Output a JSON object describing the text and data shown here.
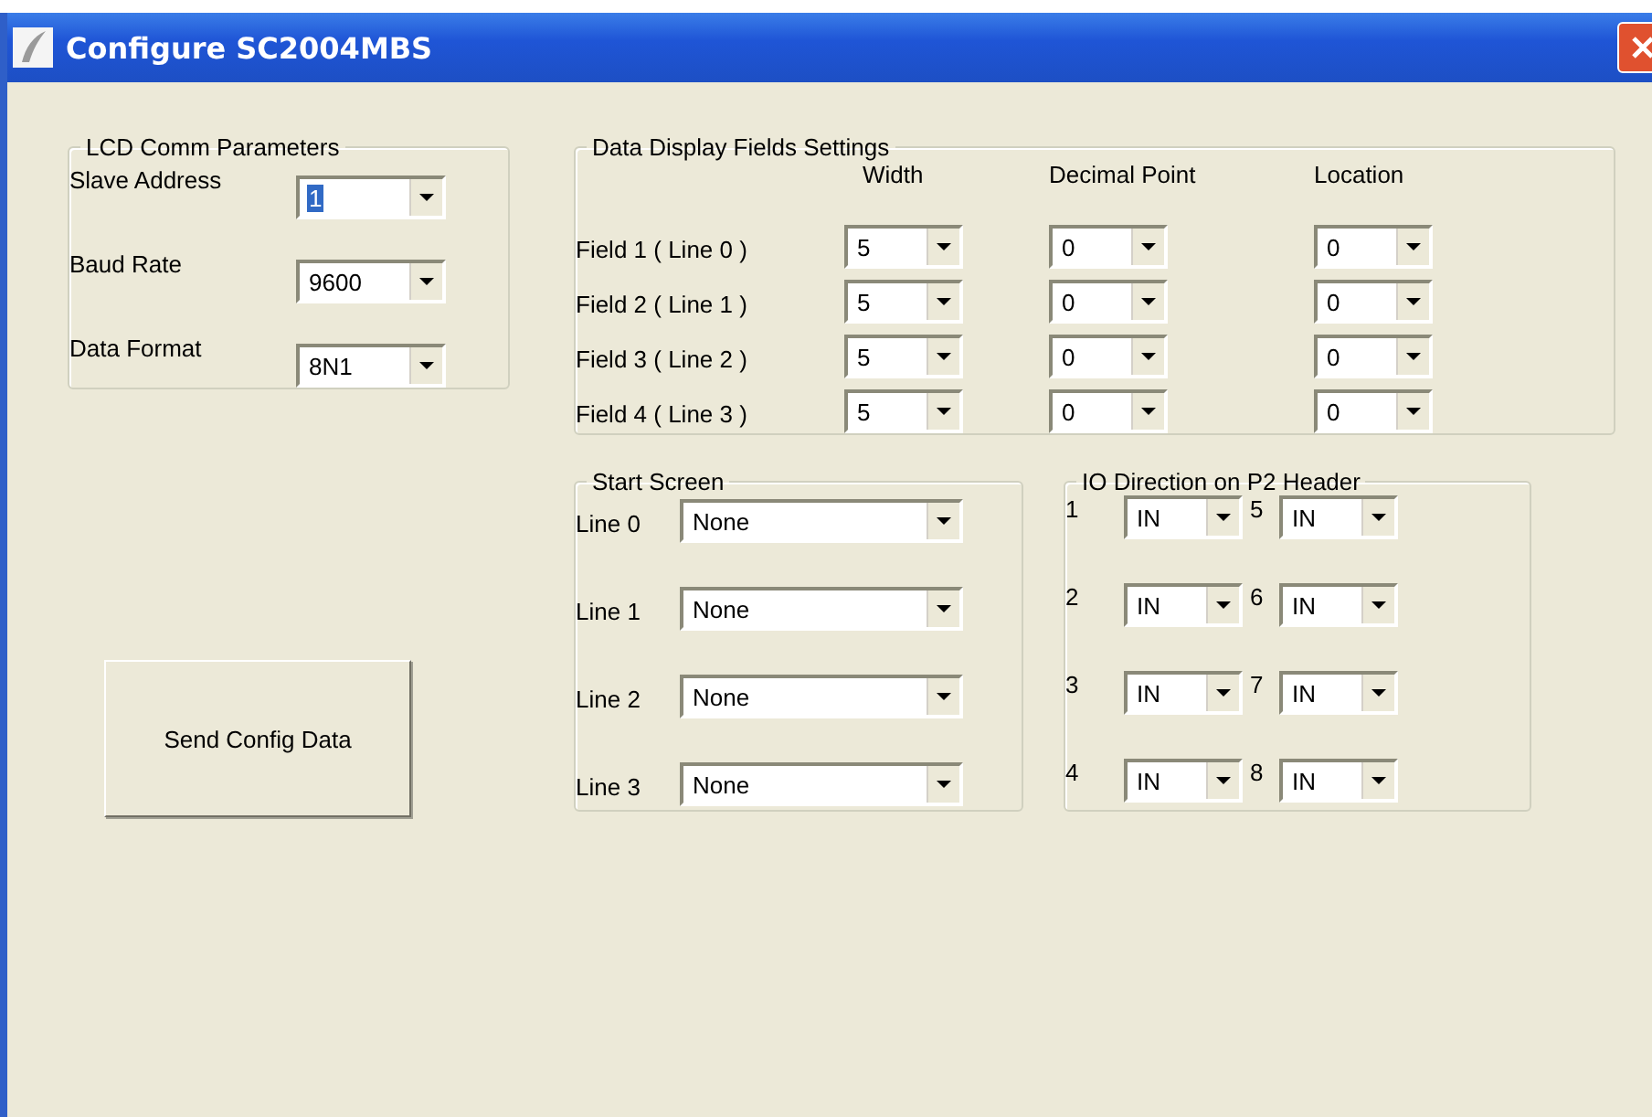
{
  "window": {
    "title": "Configure SC2004MBS"
  },
  "lcd_comm_parameters": {
    "title": "LCD Comm Parameters",
    "fields": [
      {
        "label": "Slave Address",
        "value": "1",
        "highlighted": true
      },
      {
        "label": "Baud Rate",
        "value": "9600",
        "highlighted": false
      },
      {
        "label": "Data Format",
        "value": "8N1",
        "highlighted": false
      }
    ]
  },
  "data_display_fields_settings": {
    "title": "Data Display Fields Settings",
    "columns": [
      "Width",
      "Decimal Point",
      "Location"
    ],
    "rows": [
      {
        "label": "Field 1 ( Line 0 )",
        "values": [
          "5",
          "0",
          "0"
        ]
      },
      {
        "label": "Field 2 ( Line 1 )",
        "values": [
          "5",
          "0",
          "0"
        ]
      },
      {
        "label": "Field 3 ( Line 2 )",
        "values": [
          "5",
          "0",
          "0"
        ]
      },
      {
        "label": "Field 4 ( Line 3 )",
        "values": [
          "5",
          "0",
          "0"
        ]
      }
    ]
  },
  "start_screen": {
    "title": "Start Screen",
    "lines": [
      {
        "label": "Line 0",
        "value": "None"
      },
      {
        "label": "Line 1",
        "value": "None"
      },
      {
        "label": "Line 2",
        "value": "None"
      },
      {
        "label": "Line 3",
        "value": "None"
      }
    ]
  },
  "io_direction": {
    "title": "IO Direction on P2 Header",
    "pins": [
      {
        "label": "1",
        "value": "IN"
      },
      {
        "label": "2",
        "value": "IN"
      },
      {
        "label": "3",
        "value": "IN"
      },
      {
        "label": "4",
        "value": "IN"
      },
      {
        "label": "5",
        "value": "IN"
      },
      {
        "label": "6",
        "value": "IN"
      },
      {
        "label": "7",
        "value": "IN"
      },
      {
        "label": "8",
        "value": "IN"
      }
    ]
  },
  "buttons": [
    {
      "label": "Send Config Data"
    }
  ]
}
